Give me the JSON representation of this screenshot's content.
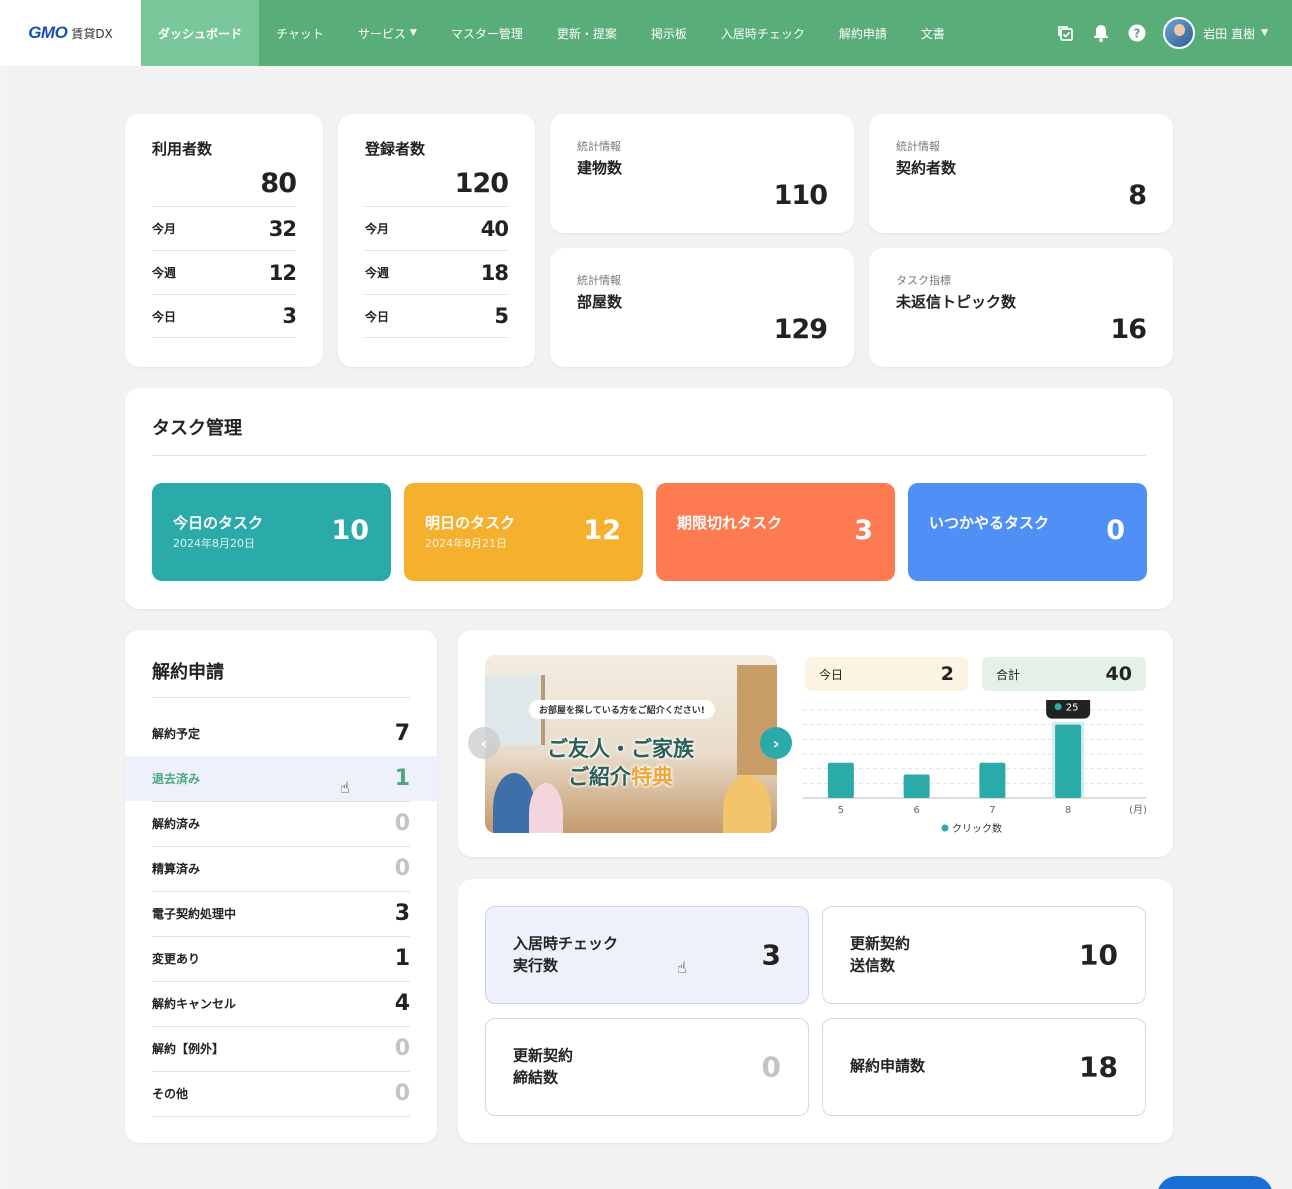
{
  "nav": {
    "brand": "GMO",
    "brand_sub": "賃貸DX",
    "items": [
      {
        "label": "ダッシュボード",
        "active": true
      },
      {
        "label": "チャット"
      },
      {
        "label": "サービス",
        "has_dropdown": true
      },
      {
        "label": "マスター管理"
      },
      {
        "label": "更新・提案"
      },
      {
        "label": "掲示板"
      },
      {
        "label": "入居時チェック"
      },
      {
        "label": "解約申請"
      },
      {
        "label": "文書"
      }
    ],
    "icons": [
      "copy-check-icon",
      "bell-icon",
      "help-icon"
    ],
    "user_name": "岩田 直樹"
  },
  "users_card": {
    "title": "利用者数",
    "total": "80",
    "rows": [
      {
        "label": "今月",
        "value": "32"
      },
      {
        "label": "今週",
        "value": "12"
      },
      {
        "label": "今日",
        "value": "3"
      }
    ]
  },
  "registered_card": {
    "title": "登録者数",
    "total": "120",
    "rows": [
      {
        "label": "今月",
        "value": "40"
      },
      {
        "label": "今週",
        "value": "18"
      },
      {
        "label": "今日",
        "value": "5"
      }
    ]
  },
  "info_cards": [
    {
      "caption": "統計情報",
      "title": "建物数",
      "value": "110"
    },
    {
      "caption": "統計情報",
      "title": "契約者数",
      "value": "8"
    },
    {
      "caption": "統計情報",
      "title": "部屋数",
      "value": "129"
    },
    {
      "caption": "タスク指標",
      "title": "未返信トピック数",
      "value": "16"
    }
  ],
  "tasks": {
    "title": "タスク管理",
    "items": [
      {
        "label": "今日のタスク",
        "date": "2024年8月20日",
        "value": "10",
        "color": "#2aaaa9"
      },
      {
        "label": "明日のタスク",
        "date": "2024年8月21日",
        "value": "12",
        "color": "#f5b02e"
      },
      {
        "label": "期限切れタスク",
        "date": "",
        "value": "3",
        "color": "#fe7b51"
      },
      {
        "label": "いつかやるタスク",
        "date": "",
        "value": "0",
        "color": "#4f8ff6"
      }
    ]
  },
  "cancellation": {
    "title": "解約申請",
    "rows": [
      {
        "label": "解約予定",
        "value": "7"
      },
      {
        "label": "退去済み",
        "value": "1",
        "highlight": true
      },
      {
        "label": "解約済み",
        "value": "0"
      },
      {
        "label": "精算済み",
        "value": "0"
      },
      {
        "label": "電子契約処理中",
        "value": "3"
      },
      {
        "label": "変更あり",
        "value": "1"
      },
      {
        "label": "解約キャンセル",
        "value": "4"
      },
      {
        "label": "解約【例外】",
        "value": "0"
      },
      {
        "label": "その他",
        "value": "0"
      }
    ]
  },
  "banner": {
    "tag": "お部屋を探している方をご紹介ください!",
    "line1": "ご友人・ご家族",
    "line2a": "ご紹介",
    "line2b": "特典"
  },
  "clicks": {
    "today_label": "今日",
    "today_value": "2",
    "total_label": "合計",
    "total_value": "40",
    "tooltip": "25",
    "legend": "クリック数"
  },
  "chart_data": {
    "type": "bar",
    "categories": [
      "5",
      "6",
      "7",
      "8"
    ],
    "values": [
      12,
      8,
      12,
      25
    ],
    "xlabel": "(月)",
    "series": [
      {
        "name": "クリック数",
        "values": [
          12,
          8,
          12,
          25
        ]
      }
    ],
    "ylim": [
      0,
      30
    ],
    "color": "#2aaaa9",
    "grid": true,
    "legend": "bottom"
  },
  "metrics": [
    {
      "label": "入居時チェック\n実行数",
      "value": "3",
      "highlight": true
    },
    {
      "label": "更新契約\n送信数",
      "value": "10"
    },
    {
      "label": "更新契約\n締結数",
      "value": "0",
      "zero": true
    },
    {
      "label": "解約申請数",
      "value": "18"
    }
  ]
}
